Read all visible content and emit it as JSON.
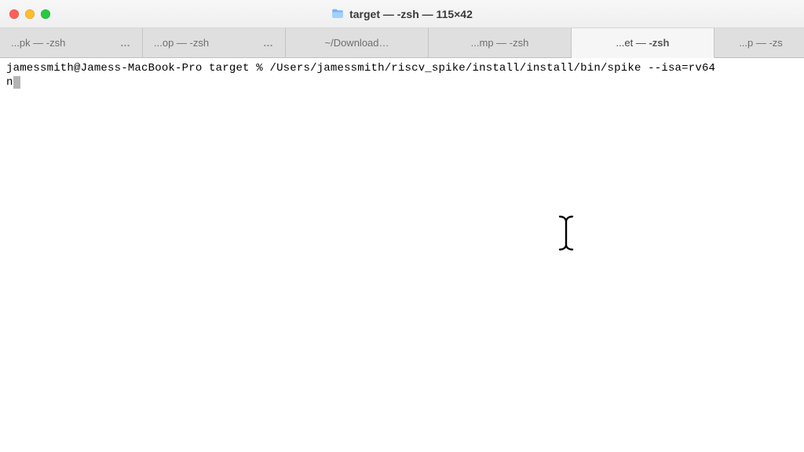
{
  "window": {
    "title": "target — -zsh — 115×42"
  },
  "tabs": [
    {
      "label": "...pk — -zsh",
      "has_overflow": true,
      "active": false
    },
    {
      "label": "...op — -zsh",
      "has_overflow": true,
      "active": false
    },
    {
      "label": "~/Download…",
      "has_overflow": false,
      "active": false
    },
    {
      "label": "...mp — -zsh",
      "has_overflow": false,
      "active": false
    },
    {
      "label": "...et — -zsh",
      "has_overflow": false,
      "active": true
    },
    {
      "label": "...p — -zs",
      "has_overflow": false,
      "active": false
    }
  ],
  "terminal": {
    "prompt": "jamessmith@Jamess-MacBook-Pro target % ",
    "command_line1": "/Users/jamessmith/riscv_spike/install/install/bin/spike --isa=rv64",
    "command_line2": "n"
  },
  "icons": {
    "folder": "folder-icon",
    "ibeam": "text-cursor-icon"
  }
}
